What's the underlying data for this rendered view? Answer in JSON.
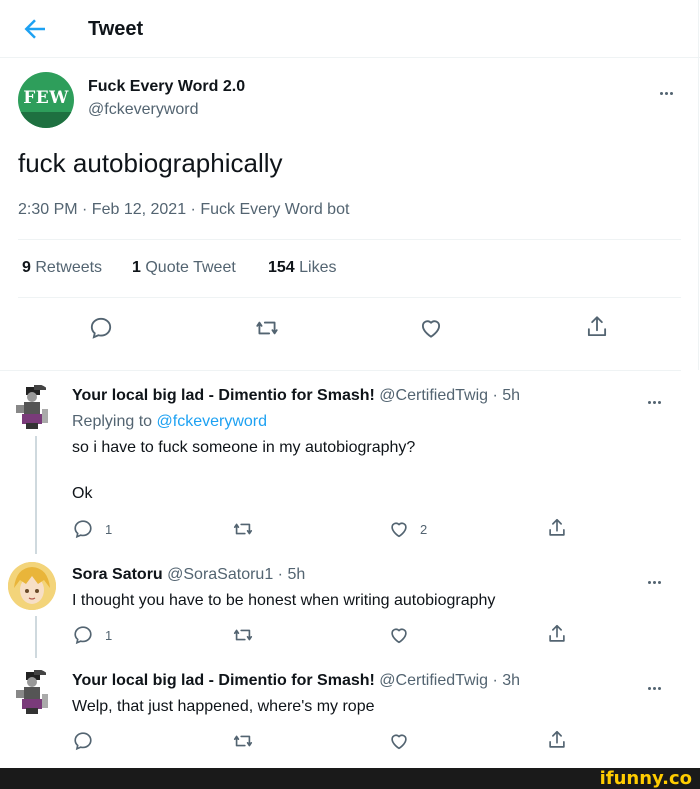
{
  "header": {
    "title": "Tweet"
  },
  "main_tweet": {
    "avatar_text": "FEW",
    "author_name": "Fuck Every Word 2.0",
    "author_handle": "@fckeveryword",
    "text": "fuck autobiographically",
    "timestamp": "2:30 PM · Feb 12, 2021 · Fuck Every Word bot",
    "stats": {
      "retweets_count": "9",
      "retweets_label": "Retweets",
      "quotes_count": "1",
      "quotes_label": "Quote Tweet",
      "likes_count": "154",
      "likes_label": "Likes"
    }
  },
  "replies": [
    {
      "name": "Your local big lad - Dimentio for Smash!",
      "handle": "@CertifiedTwig",
      "time": "· 5h",
      "replying_prefix": "Replying to",
      "replying_to": "@fckeveryword",
      "text_line1": "so i have to fuck someone in my autobiography?",
      "text_line2": "Ok",
      "reply_count": "1",
      "retweet_count": "",
      "like_count": "2"
    },
    {
      "name": "Sora Satoru",
      "handle": "@SoraSatoru1",
      "time": "· 5h",
      "text_line1": "I thought you have to be honest when writing autobiography",
      "reply_count": "1",
      "retweet_count": "",
      "like_count": ""
    },
    {
      "name": "Your local big lad - Dimentio for Smash!",
      "handle": "@CertifiedTwig",
      "time": "· 3h",
      "text_line1": "Welp, that just happened, where's my rope",
      "reply_count": "",
      "retweet_count": "",
      "like_count": ""
    }
  ],
  "watermark": {
    "text": "ifunny.co"
  },
  "colors": {
    "accent": "#1da1f2",
    "secondary_text": "#536471",
    "avatar_green": "#2e9e5b"
  }
}
